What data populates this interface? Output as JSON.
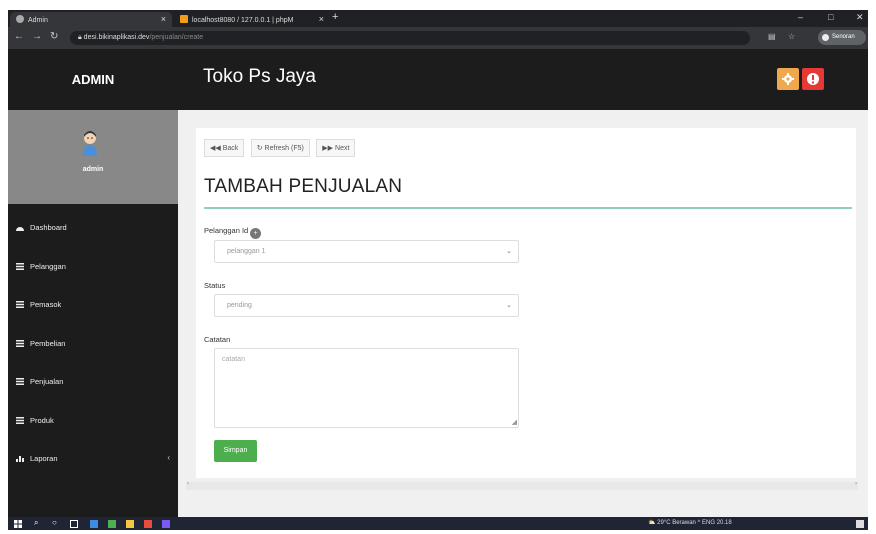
{
  "browser": {
    "tab_active_label": "Admin",
    "tab_inactive_label": "localhost8080 / 127.0.0.1 | phpM",
    "url_host": "desi.bikinaplikasi.dev",
    "url_path": "/penjualan/create",
    "profile_label": "Senoran"
  },
  "header": {
    "brand": "ADMIN",
    "app_title": "Toko Ps Jaya"
  },
  "sidebar": {
    "username": "admin",
    "items": [
      {
        "label": "Dashboard",
        "icon": "dashboard-icon"
      },
      {
        "label": "Pelanggan",
        "icon": "list-icon"
      },
      {
        "label": "Pemasok",
        "icon": "list-icon"
      },
      {
        "label": "Pembelian",
        "icon": "list-icon"
      },
      {
        "label": "Penjualan",
        "icon": "list-icon"
      },
      {
        "label": "Produk",
        "icon": "list-icon"
      },
      {
        "label": "Laporan",
        "icon": "chart-icon"
      }
    ]
  },
  "toolbar": {
    "back_label": "Back",
    "refresh_label": "Refresh (F5)",
    "next_label": "Next"
  },
  "page": {
    "title": "TAMBAH PENJUALAN"
  },
  "form": {
    "pelanggan_label": "Pelanggan Id",
    "pelanggan_value": "pelanggan 1",
    "status_label": "Status",
    "status_value": "pending",
    "catatan_label": "Catatan",
    "catatan_placeholder": "catatan",
    "submit_label": "Simpan"
  },
  "taskbar": {
    "tray_text": "29°C Berawan  ^  ENG  20.18"
  },
  "colors": {
    "header_bg": "#1c1c1c",
    "save_button": "#4cae4c",
    "settings_button": "#f0a84c",
    "alert_button": "#e53935",
    "divider": "#8fcfbd"
  }
}
